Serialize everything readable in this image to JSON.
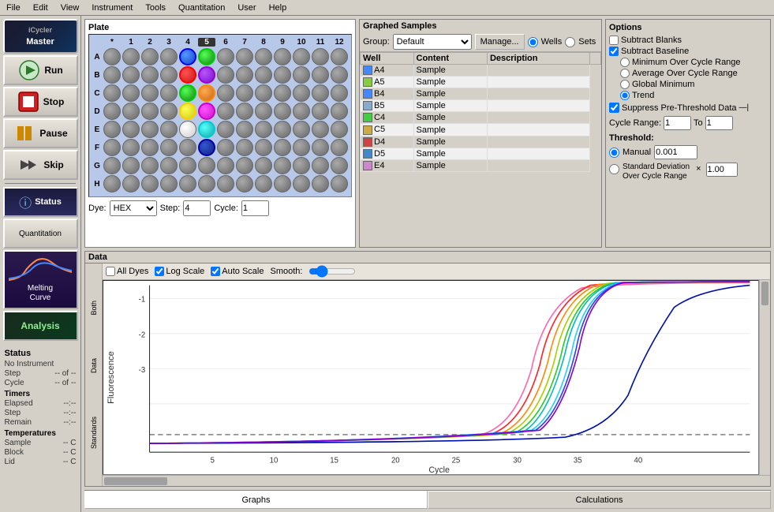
{
  "menubar": {
    "items": [
      "File",
      "Edit",
      "View",
      "Instrument",
      "Tools",
      "Quantitation",
      "User",
      "Help"
    ]
  },
  "sidebar": {
    "master_label": "Master",
    "run_label": "Run",
    "stop_label": "Stop",
    "pause_label": "Pause",
    "skip_label": "Skip",
    "status_label": "Status",
    "quantitation_label": "Quantitation",
    "melting_curve_label": "Melting\nCurve",
    "analysis_label": "Analysis"
  },
  "status_panel": {
    "title": "Status",
    "instrument": "No Instrument",
    "step_label": "Step",
    "step_value": "-- of --",
    "cycle_label": "Cycle",
    "cycle_value": "-- of --",
    "timers_label": "Timers",
    "elapsed_label": "Elapsed",
    "elapsed_value": "--:--",
    "step_time_label": "Step",
    "step_time_value": "--:--",
    "remain_label": "Remain",
    "remain_value": "--:--",
    "temperatures_label": "Temperatures",
    "sample_label": "Sample",
    "sample_value": "-- C",
    "block_label": "Block",
    "block_value": "-- C",
    "lid_label": "Lid",
    "lid_value": "-- C"
  },
  "plate": {
    "title": "Plate",
    "col_headers": [
      "*",
      "1",
      "2",
      "3",
      "4",
      "5",
      "6",
      "7",
      "8",
      "9",
      "10",
      "11",
      "12"
    ],
    "rows": [
      "A",
      "B",
      "C",
      "D",
      "E",
      "F",
      "G",
      "H"
    ],
    "dye_label": "Dye:",
    "dye_value": "HEX",
    "step_label": "Step:",
    "step_value": "4",
    "cycle_label": "Cycle:",
    "cycle_value": "1"
  },
  "graphed_samples": {
    "title": "Graphed Samples",
    "group_label": "Group:",
    "group_value": "Default",
    "manage_label": "Manage...",
    "wells_label": "Wells",
    "sets_label": "Sets",
    "columns": [
      "Well",
      "Content",
      "Description"
    ],
    "rows": [
      {
        "color": "#4488ff",
        "well": "A4",
        "content": "Sample",
        "description": ""
      },
      {
        "color": "#88cc44",
        "well": "A5",
        "content": "Sample",
        "description": ""
      },
      {
        "color": "#4488ff",
        "well": "B4",
        "content": "Sample",
        "description": ""
      },
      {
        "color": "#88aacc",
        "well": "B5",
        "content": "Sample",
        "description": ""
      },
      {
        "color": "#44cc44",
        "well": "C4",
        "content": "Sample",
        "description": ""
      },
      {
        "color": "#ccaa44",
        "well": "C5",
        "content": "Sample",
        "description": ""
      },
      {
        "color": "#cc4444",
        "well": "D4",
        "content": "Sample",
        "description": ""
      },
      {
        "color": "#4488cc",
        "well": "D5",
        "content": "Sample",
        "description": ""
      },
      {
        "color": "#cc88cc",
        "well": "E4",
        "content": "Sample",
        "description": ""
      }
    ]
  },
  "options": {
    "title": "Options",
    "subtract_blanks": "Subtract Blanks",
    "subtract_baseline": "Subtract Baseline",
    "min_over_cycle": "Minimum Over Cycle Range",
    "avg_over_cycle": "Average Over Cycle Range",
    "global_minimum": "Global Minimum",
    "trend": "Trend",
    "suppress_pre_threshold": "Suppress Pre-Threshold Data",
    "cycle_range_label": "Cycle Range:",
    "cycle_from": "1",
    "cycle_to_label": "To",
    "cycle_to": "1",
    "threshold_title": "Threshold:",
    "manual_label": "Manual",
    "manual_value": "0.001",
    "std_dev_label": "Standard Deviation\nOver Cycle Range",
    "std_dev_value": "1.00"
  },
  "chart": {
    "title": "Data",
    "all_dyes_label": "All Dyes",
    "log_scale_label": "Log Scale",
    "auto_scale_label": "Auto Scale",
    "smooth_label": "Smooth:",
    "y_axis_label": "Fluorescence",
    "x_axis_label": "Cycle",
    "left_labels": [
      "Both",
      "Data",
      "Standards"
    ],
    "x_ticks": [
      "5",
      "10",
      "15",
      "20",
      "25",
      "30",
      "35",
      "40"
    ],
    "y_ticks": [
      "-1",
      "-2",
      "-3"
    ]
  },
  "bottom_tabs": {
    "graphs_label": "Graphs",
    "calculations_label": "Calculations"
  }
}
